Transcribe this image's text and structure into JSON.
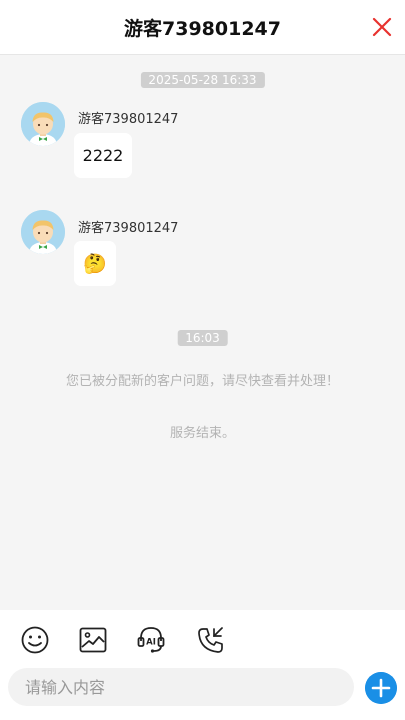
{
  "header": {
    "title": "游客739801247"
  },
  "messages": [
    {
      "sender": "游客739801247",
      "text": "2222"
    },
    {
      "sender": "游客739801247",
      "emoji": "🤔"
    }
  ],
  "timestamps": {
    "first": "2025-05-28 16:33",
    "second": "16:03"
  },
  "system": {
    "assigned": "您已被分配新的客户问题，请尽快查看并处理！",
    "ended": "服务结束。"
  },
  "composer": {
    "placeholder": "请输入内容"
  },
  "colors": {
    "accent": "#1a8fe6",
    "close": "#e8322f"
  },
  "toolbar_icons": [
    "emoji-icon",
    "image-icon",
    "ai-agent-icon",
    "phone-transfer-icon"
  ]
}
